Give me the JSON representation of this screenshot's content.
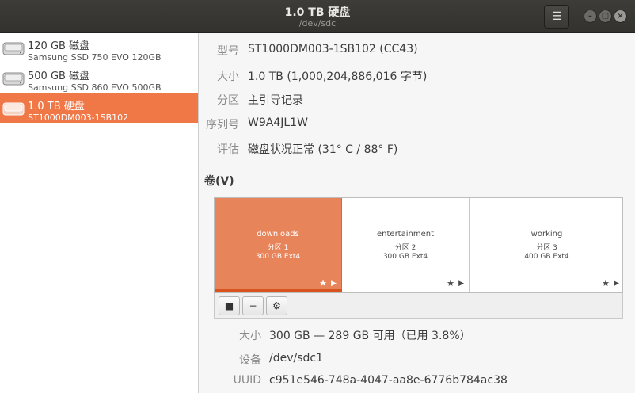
{
  "window": {
    "title": "1.0 TB 硬盘",
    "subtitle": "/dev/sdc",
    "menu_icon": "hamburger-icon",
    "controls": {
      "minimize": "–",
      "maximize": "▢",
      "close": "×"
    }
  },
  "sidebar": {
    "drives": [
      {
        "name": "120 GB 磁盘",
        "model": "Samsung SSD 750 EVO 120GB",
        "selected": false
      },
      {
        "name": "500 GB 磁盘",
        "model": "Samsung SSD 860 EVO 500GB",
        "selected": false
      },
      {
        "name": "1.0 TB 硬盘",
        "model": "ST1000DM003-1SB102",
        "selected": true
      }
    ]
  },
  "details": {
    "model_label": "型号",
    "model_value": "ST1000DM003-1SB102 (CC43)",
    "size_label": "大小",
    "size_value": "1.0 TB (1,000,204,886,016 字节)",
    "partition_label": "分区",
    "partition_value": "主引导记录",
    "serial_label": "序列号",
    "serial_value": "W9A4JL1W",
    "assessment_label": "评估",
    "assessment_value": "磁盘状况正常 (31° C / 88° F)"
  },
  "volumes": {
    "title": "卷(V)",
    "partitions": [
      {
        "name": "downloads",
        "index": "分区 1",
        "info": "300 GB Ext4"
      },
      {
        "name": "entertainment",
        "index": "分区 2",
        "info": "300 GB Ext4"
      },
      {
        "name": "working",
        "index": "分区 3",
        "info": "400 GB Ext4"
      }
    ],
    "star_glyph": "★",
    "play_glyph": "▶",
    "toolbar": {
      "stop": "■",
      "remove": "−",
      "settings": "⚙"
    }
  },
  "volume_details": {
    "size_label": "大小",
    "size_value": "300 GB — 289 GB 可用（已用 3.8%）",
    "device_label": "设备",
    "device_value": "/dev/sdc1",
    "uuid_label": "UUID",
    "uuid_value": "c951e546-748a-4047-aa8e-6776b784ac38"
  },
  "colors": {
    "accent": "#f07746",
    "partition_selected": "#e8845a",
    "titlebar": "#3d3c38"
  }
}
